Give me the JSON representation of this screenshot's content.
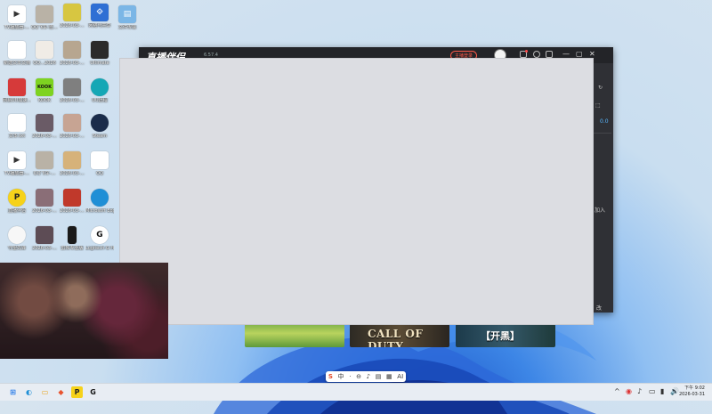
{
  "desktop": {
    "icons": [
      {
        "label": "TV播放器-…",
        "glyph": "▶",
        "bg": "#ffffff",
        "fg": "#333333"
      },
      {
        "label": "QQ飞车-雪…",
        "glyph": "",
        "bg": "#b9b2a6",
        "fg": "#333333"
      },
      {
        "label": "2026-03-…",
        "glyph": "",
        "bg": "#d7c641",
        "fg": "#333333"
      },
      {
        "label": "网络与共享",
        "glyph": "⟐",
        "bg": "#2f6fd4",
        "fg": "#ffffff"
      },
      {
        "label": "文件传输",
        "glyph": "▤",
        "bg": "#7bb6e6",
        "fg": "#ffffff"
      },
      {
        "label": "新建文本文档",
        "glyph": "",
        "bg": "#ffffff",
        "fg": "#333333"
      },
      {
        "label": "QQ…2026",
        "glyph": "",
        "bg": "#f0ece6",
        "fg": "#333333"
      },
      {
        "label": "2026-03-…",
        "glyph": "",
        "bg": "#b7a690",
        "fg": "#333333"
      },
      {
        "label": "Ultimate",
        "glyph": "",
        "bg": "#2b2b2b",
        "fg": "#f0a020"
      },
      {
        "label": "网易UU加速…",
        "glyph": "",
        "bg": "#d63a3a",
        "fg": "#ffffff"
      },
      {
        "label": "KOOK",
        "glyph": "KOOK",
        "bg": "#7ed321",
        "fg": "#111111"
      },
      {
        "label": "2026-03-…",
        "glyph": "",
        "bg": "#7f7f7f",
        "fg": "#ffffff"
      },
      {
        "label": "UU远程",
        "glyph": "",
        "bg": "#15a7b5",
        "fg": "#ffffff"
      },
      {
        "label": "文本.txt",
        "glyph": "",
        "bg": "#ffffff",
        "fg": "#333333"
      },
      {
        "label": "2026-03-…",
        "glyph": "",
        "bg": "#6a5b66",
        "fg": "#ffffff"
      },
      {
        "label": "2026-03-…",
        "glyph": "",
        "bg": "#c7a493",
        "fg": "#ffffff"
      },
      {
        "label": "Steam",
        "glyph": "",
        "bg": "#1a2c4a",
        "fg": "#ffffff"
      },
      {
        "label": "TV播放器-…",
        "glyph": "▶",
        "bg": "#ffffff",
        "fg": "#333333"
      },
      {
        "label": "QQ飞车-…",
        "glyph": "",
        "bg": "#b9b2a6",
        "fg": "#333333"
      },
      {
        "label": "2026-03-…",
        "glyph": "",
        "bg": "#d6b27a",
        "fg": "#333333"
      },
      {
        "label": "QQ",
        "glyph": "",
        "bg": "#ffffff",
        "fg": "#111111"
      },
      {
        "label": "直播伴侣",
        "glyph": "P",
        "bg": "#f6d21a",
        "fg": "#222222"
      },
      {
        "label": "2026-03-…",
        "glyph": "",
        "bg": "#8a6e77",
        "fg": "#ffffff"
      },
      {
        "label": "2026-03-…",
        "glyph": "",
        "bg": "#c0392b",
        "fg": "#ffffff"
      },
      {
        "label": "Microsoft Edge",
        "glyph": "",
        "bg": "#1f8fd6",
        "fg": "#ffffff"
      },
      {
        "label": "守望先锋",
        "glyph": "",
        "bg": "#f7f7f7",
        "fg": "#333333"
      },
      {
        "label": "2026-03-…",
        "glyph": "",
        "bg": "#5d4c55",
        "fg": "#ffffff"
      },
      {
        "label": "剪映专业版",
        "glyph": "",
        "bg": "#1a1a1a",
        "fg": "#ffffff"
      },
      {
        "label": "Logitech G HUB",
        "glyph": "G",
        "bg": "#ffffff",
        "fg": "#111111"
      }
    ]
  },
  "app": {
    "logo": "直播伴侣",
    "version": "6.57.4",
    "login_label": "主播登录",
    "right_panel": {
      "value": "0.0",
      "join": "加入",
      "tail": "改"
    }
  },
  "thumbnails": [
    {
      "text": ""
    },
    {
      "text": "CALL OF DUTY"
    },
    {
      "text": "【开黑】"
    }
  ],
  "ime": {
    "items": [
      "S",
      "中",
      "·",
      "⊖",
      "♪",
      "▤",
      "▦",
      "AI"
    ]
  },
  "taskbar": {
    "apps": [
      {
        "name": "start",
        "glyph": "⊞",
        "fg": "#1a73e8",
        "bg": "transparent"
      },
      {
        "name": "edge",
        "glyph": "◐",
        "fg": "#1f8fd6",
        "bg": "transparent"
      },
      {
        "name": "file-explorer",
        "glyph": "▭",
        "fg": "#e8a317",
        "bg": "transparent"
      },
      {
        "name": "app-red",
        "glyph": "◆",
        "fg": "#e8532e",
        "bg": "transparent"
      },
      {
        "name": "live-companion",
        "glyph": "P",
        "fg": "#222222",
        "bg": "#f6d21a"
      },
      {
        "name": "logitech",
        "glyph": "G",
        "fg": "#111111",
        "bg": "transparent"
      }
    ],
    "tray": [
      "^",
      "◉",
      "♪",
      "▭",
      "▮",
      "🔊"
    ],
    "time": "下午 9:02",
    "date": "2026-03-31"
  }
}
